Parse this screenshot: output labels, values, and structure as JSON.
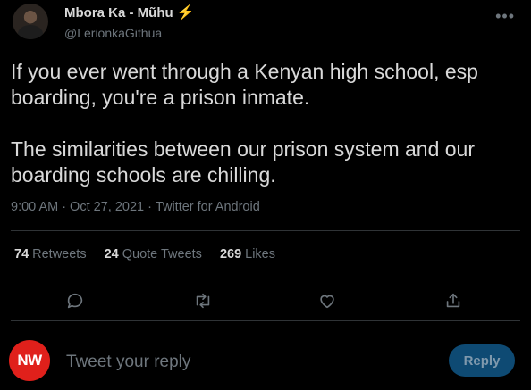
{
  "author": {
    "display_name": "Mbora Ka - Mũhu",
    "emoji": "⚡",
    "handle": "@LerionkaGithua"
  },
  "tweet": {
    "text": "If you ever went through a Kenyan high school, esp boarding, you're a prison inmate.\n\nThe similarities between our prison system and our boarding schools are chilling.",
    "time": "9:00 AM",
    "separator": "·",
    "date": "Oct 27, 2021",
    "source": "Twitter for Android"
  },
  "stats": {
    "retweets_count": "74",
    "retweets_label": "Retweets",
    "quote_count": "24",
    "quote_label": "Quote Tweets",
    "likes_count": "269",
    "likes_label": "Likes"
  },
  "actions": [
    "reply-icon",
    "retweet-icon",
    "like-icon",
    "share-icon"
  ],
  "reply_box": {
    "avatar_text": "NW",
    "placeholder": "Tweet your reply",
    "button_label": "Reply"
  },
  "colors": {
    "background": "#000000",
    "text": "#d9d9d9",
    "muted": "#6e767d",
    "accent": "#1d9bf0",
    "avatar_red": "#e0201b"
  }
}
